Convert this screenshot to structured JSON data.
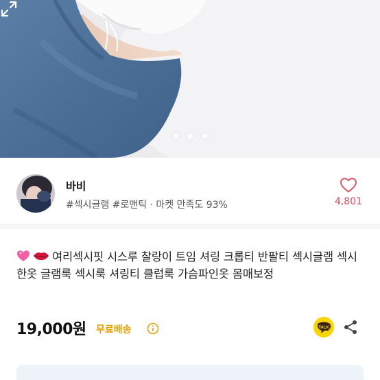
{
  "gallery": {
    "icons": {
      "expand": "expand-arrows-icon"
    },
    "page_indicator": {
      "total": 3,
      "active": 2
    }
  },
  "seller": {
    "name": "바비",
    "tags": "#섹시글램 #로맨틱 · 마켓 만족도 93%",
    "like_count": "4,801",
    "icons": {
      "like": "heart-outline-icon",
      "avatar": "avatar-image"
    }
  },
  "product": {
    "title": "여리섹시핏 시스루 찰랑이 트임 셔링 크롭티 반팔티 섹시글램 섹시한옷 글램룩 섹시룩 셔링티 클럽룩 가슴파인옷 몸매보정",
    "title_icons": [
      "sparkling-heart-emoji",
      "kiss-lips-emoji"
    ],
    "price": "19,000원",
    "shipping": "무료배송",
    "icons": {
      "shipping_info": "info-icon",
      "talk": "kakaotalk-icon",
      "share": "share-icon"
    }
  },
  "colors": {
    "like": "#e0485d",
    "shipping": "#e6a000",
    "talk_bubble": "#f7d600"
  }
}
